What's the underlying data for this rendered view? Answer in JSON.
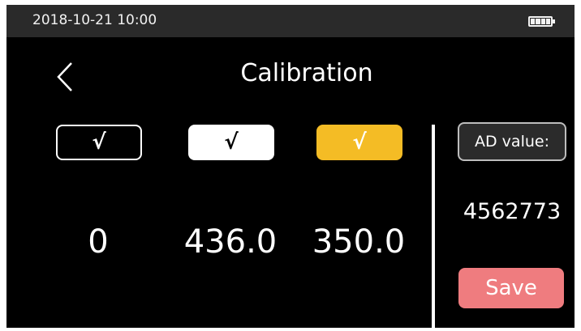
{
  "status_bar": {
    "datetime": "2018-10-21  10:00",
    "battery_icon": "battery-full-icon",
    "battery_level": 1.0
  },
  "header": {
    "back_icon": "chevron-left-icon",
    "title": "Calibration"
  },
  "calibration": {
    "checks": [
      {
        "label": "√",
        "style": "outline",
        "color": "#ffffff"
      },
      {
        "label": "√",
        "style": "filled-white",
        "color": "#ffffff"
      },
      {
        "label": "√",
        "style": "filled-yellow",
        "color": "#f4bc25"
      }
    ],
    "values": [
      "0",
      "436.0",
      "350.0"
    ]
  },
  "ad": {
    "label": "AD value:",
    "value": "4562773"
  },
  "actions": {
    "save_label": "Save",
    "save_color": "#ef7c7f"
  }
}
